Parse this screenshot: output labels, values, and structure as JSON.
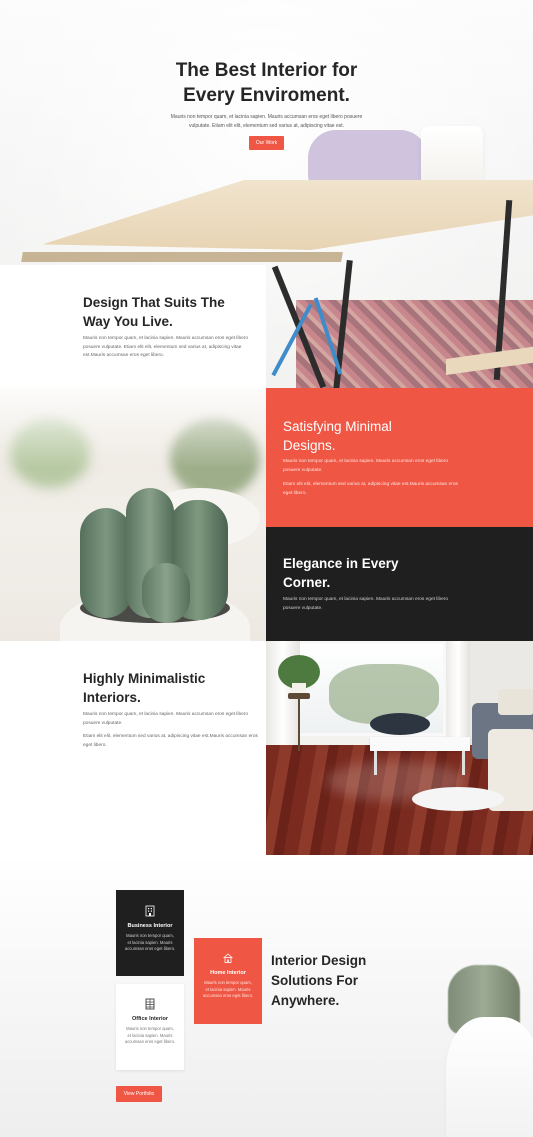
{
  "hero": {
    "title_line1": "The Best Interior for",
    "title_line2": "Every Enviroment.",
    "text": "Mauris non tempor quam, et lacinia sapien. Mauris accumsan eros eget libero posuere vulputate. Etiam elit elit, elementum sed varius at, adipiscing vitae est.",
    "button_label": "Our Work"
  },
  "suits": {
    "title_line1": "Design That Suits The",
    "title_line2": "Way You Live.",
    "text": "Mauris non tempor quam, et lacinia sapien. Mauris accumsan eros eget libero posuere vulputate. Etiam elit elit, elementum sed varius at, adipiscing vitae est.Mauris accumsan eros eget libero."
  },
  "minimal": {
    "title_line1": "Satisfying Minimal",
    "title_line2": "Designs.",
    "text1": "Mauris non tempor quam, et lacinia sapien. Mauris accumsan eros eget libero posuere vulputate.",
    "text2": "Etiam elit elit, elementum sed varius at, adipiscing vitae est.Mauris accumsan eros eget libero."
  },
  "elegance": {
    "title_line1": "Elegance in Every",
    "title_line2": "Corner.",
    "text": "Mauris non tempor quam, et lacinia sapien. Mauris accumsan eros eget libero posuere vulputate."
  },
  "highly": {
    "title_line1": "Highly Minimalistic",
    "title_line2": "Interiors.",
    "text1": "Mauris non tempor quam, et lacinia sapien. Mauris accumsan eros eget libero posuere vulputate.",
    "text2": "Etiam elit elit, elementum sed varius at, adipiscing vitae est.Mauris accumsan eros eget libero."
  },
  "services": [
    {
      "title": "Business Interior",
      "text": "Mauris non tempor quam, et lacinia sapien. Mauris accumsan eros eget libero.",
      "icon": "building-icon"
    },
    {
      "title": "Home Interior",
      "text": "Mauris non tempor quam, et lacinia sapien. Mauris accumsan eros eget libero.",
      "icon": "home-icon"
    },
    {
      "title": "Office Interior",
      "text": "Mauris non tempor quam, et lacinia sapien. Mauris accumsan eros eget libero.",
      "icon": "office-icon"
    }
  ],
  "interior": {
    "title_line1": "Interior Design",
    "title_line2": "Solutions For",
    "title_line3": "Anywhere."
  },
  "portfolio_button_label": "View Portfolio",
  "colors": {
    "accent": "#ef5744",
    "dark": "#1f1f1f",
    "heading": "#262626"
  }
}
